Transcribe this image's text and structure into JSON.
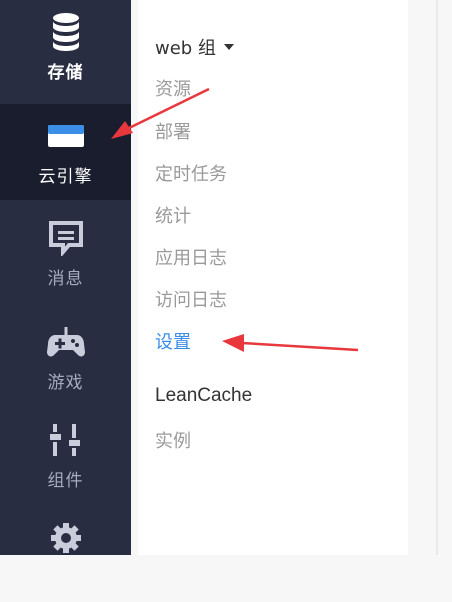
{
  "nav": {
    "items": [
      {
        "label": "存储",
        "icon": "database-icon"
      },
      {
        "label": "云引擎",
        "icon": "server-icon"
      },
      {
        "label": "消息",
        "icon": "message-icon"
      },
      {
        "label": "游戏",
        "icon": "gamepad-icon"
      },
      {
        "label": "组件",
        "icon": "sliders-icon"
      },
      {
        "label": "",
        "icon": "gear-icon"
      }
    ]
  },
  "panel": {
    "group_title": "web 组",
    "menu": [
      {
        "label": "资源"
      },
      {
        "label": "部署"
      },
      {
        "label": "定时任务"
      },
      {
        "label": "统计"
      },
      {
        "label": "应用日志"
      },
      {
        "label": "访问日志"
      },
      {
        "label": "设置"
      },
      {
        "label": "LeanCache"
      },
      {
        "label": "实例"
      }
    ]
  },
  "colors": {
    "nav_bg": "#292d42",
    "nav_active_bg": "#1a1d2d",
    "link_active": "#3a8ee6",
    "annotation_arrow": "#e8383d"
  }
}
